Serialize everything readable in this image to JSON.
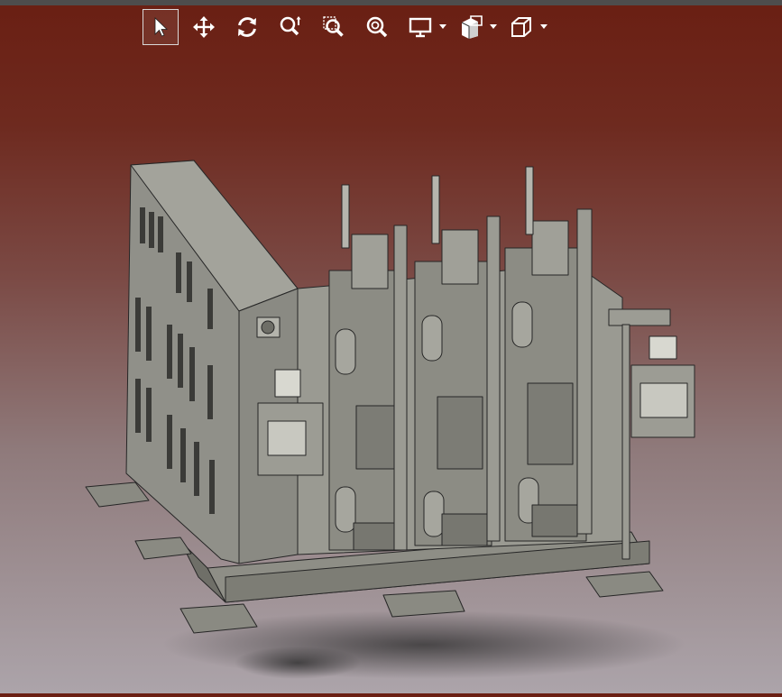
{
  "toolbar": {
    "tools": [
      {
        "name": "select",
        "icon": "cursor-arrow-icon",
        "active": true
      },
      {
        "name": "pan",
        "icon": "move-arrows-icon"
      },
      {
        "name": "rotate",
        "icon": "rotate-icon"
      },
      {
        "name": "zoom",
        "icon": "zoom-icon"
      },
      {
        "name": "zoom-window",
        "icon": "zoom-window-icon"
      },
      {
        "name": "zoom-fit",
        "icon": "zoom-fit-icon"
      },
      {
        "name": "display-mode",
        "icon": "monitor-icon",
        "dropdown": true
      },
      {
        "name": "section",
        "icon": "section-cube-icon",
        "dropdown": true
      },
      {
        "name": "view-orientation",
        "icon": "wireframe-cube-icon",
        "dropdown": true
      }
    ]
  },
  "colors": {
    "background_top": "#6a1f13",
    "background_bottom": "#aca4aa",
    "icon": "#ffffff",
    "model_body": "#8b8b82",
    "model_edge": "#262626"
  }
}
